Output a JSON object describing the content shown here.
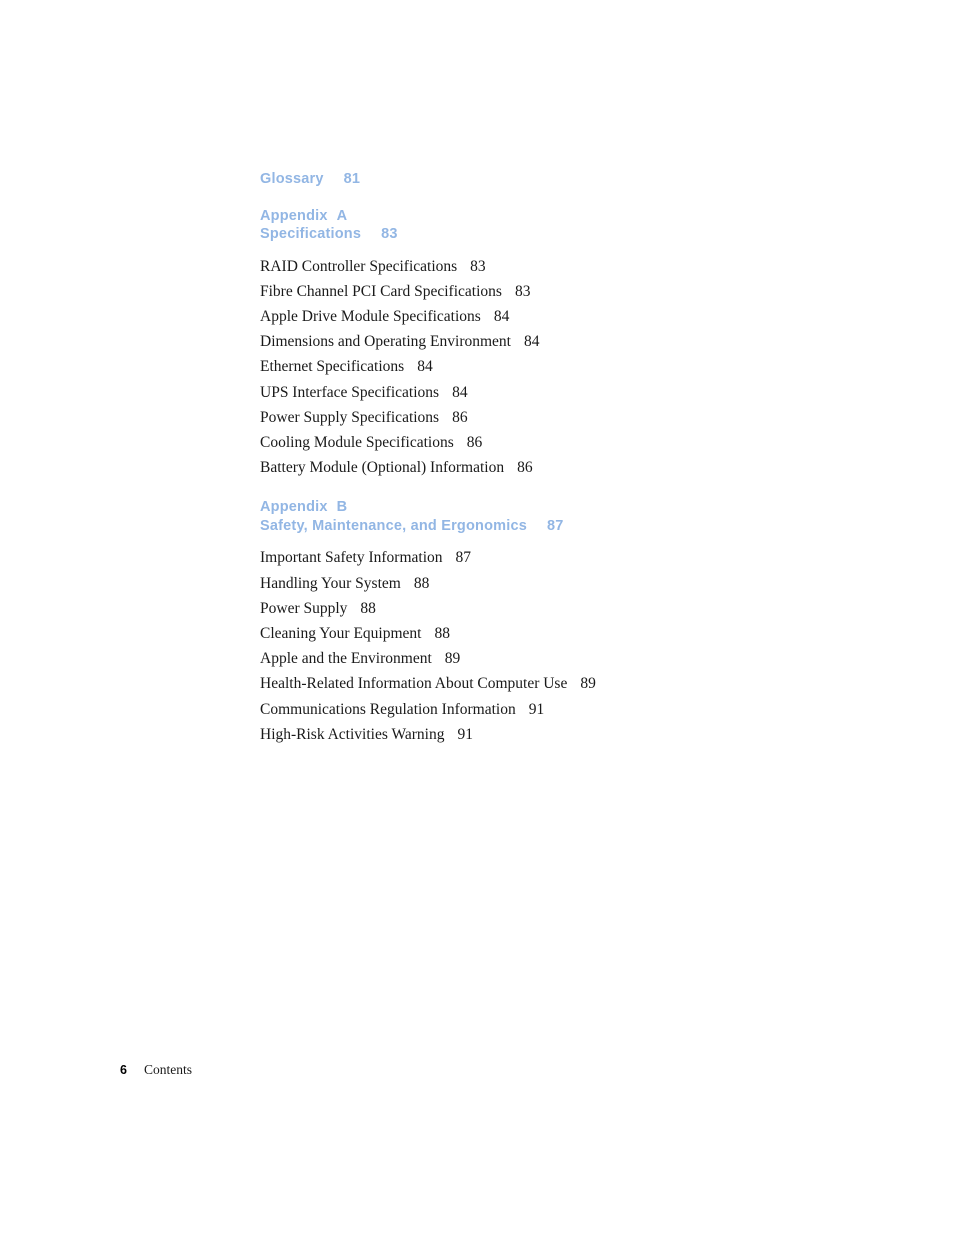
{
  "document": {
    "section_name": "Contents",
    "page_number": "6"
  },
  "toc": {
    "glossary": {
      "title": "Glossary",
      "page": "81"
    },
    "appendix_a": {
      "label": "Appendix",
      "letter": "A",
      "title": "Specifications",
      "page": "83",
      "entries": [
        {
          "title": "RAID Controller Specifications",
          "page": "83"
        },
        {
          "title": "Fibre Channel PCI Card Specifications",
          "page": "83"
        },
        {
          "title": "Apple Drive Module Specifications",
          "page": "84"
        },
        {
          "title": "Dimensions and Operating Environment",
          "page": "84"
        },
        {
          "title": "Ethernet Specifications",
          "page": "84"
        },
        {
          "title": "UPS Interface Specifications",
          "page": "84"
        },
        {
          "title": "Power Supply Specifications",
          "page": "86"
        },
        {
          "title": "Cooling Module Specifications",
          "page": "86"
        },
        {
          "title": "Battery Module (Optional) Information",
          "page": "86"
        }
      ]
    },
    "appendix_b": {
      "label": "Appendix",
      "letter": "B",
      "title": "Safety, Maintenance, and Ergonomics",
      "page": "87",
      "entries": [
        {
          "title": "Important Safety Information",
          "page": "87"
        },
        {
          "title": "Handling Your System",
          "page": "88"
        },
        {
          "title": "Power Supply",
          "page": "88"
        },
        {
          "title": "Cleaning Your Equipment",
          "page": "88"
        },
        {
          "title": "Apple and the Environment",
          "page": "89"
        },
        {
          "title": "Health-Related Information About Computer Use",
          "page": "89"
        },
        {
          "title": "Communications Regulation Information",
          "page": "91"
        },
        {
          "title": "High-Risk Activities Warning",
          "page": "91"
        }
      ]
    }
  },
  "colors": {
    "heading_blue": "#92b6e4",
    "body_text": "#1a1a1a",
    "page_background": "#ffffff"
  }
}
